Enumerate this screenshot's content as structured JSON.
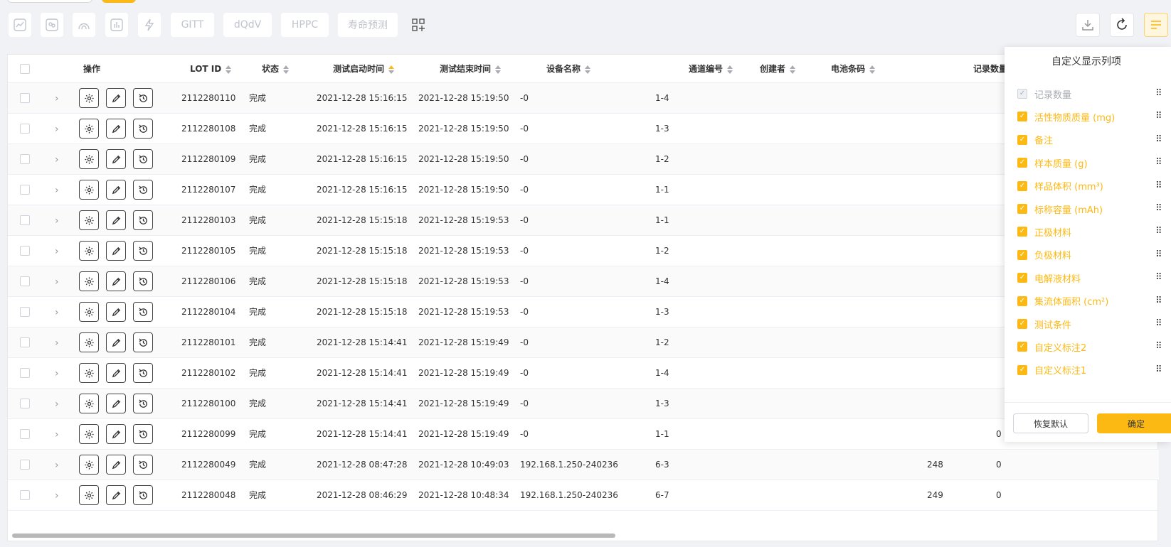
{
  "toolbar": {
    "icons": [
      "line-chart-icon",
      "cycle-icon",
      "arc-icon",
      "bar-chart-icon",
      "lightning-icon"
    ],
    "text_buttons": [
      "GITT",
      "dQdV",
      "HPPC",
      "寿命预测"
    ],
    "add_icon": "grid-add-icon",
    "right": [
      "download-icon",
      "refresh-icon",
      "columns-menu-icon"
    ]
  },
  "table": {
    "headers": {
      "ops": "操作",
      "lot": "LOT ID",
      "status": "状态",
      "start": "测试启动时间",
      "end": "测试结束时间",
      "device": "设备名称",
      "channel": "通道编号",
      "creator": "创建者",
      "barcode": "电池条码",
      "records": "记录数量"
    },
    "rows": [
      {
        "lot": "2112280110",
        "status": "完成",
        "start": "2021-12-28 15:16:15",
        "end": "2021-12-28 15:19:50",
        "device": "-0",
        "channel": "1-4",
        "records": "",
        "extra": ""
      },
      {
        "lot": "2112280108",
        "status": "完成",
        "start": "2021-12-28 15:16:15",
        "end": "2021-12-28 15:19:50",
        "device": "-0",
        "channel": "1-3",
        "records": "",
        "extra": ""
      },
      {
        "lot": "2112280109",
        "status": "完成",
        "start": "2021-12-28 15:16:15",
        "end": "2021-12-28 15:19:50",
        "device": "-0",
        "channel": "1-2",
        "records": "",
        "extra": ""
      },
      {
        "lot": "2112280107",
        "status": "完成",
        "start": "2021-12-28 15:16:15",
        "end": "2021-12-28 15:19:50",
        "device": "-0",
        "channel": "1-1",
        "records": "",
        "extra": ""
      },
      {
        "lot": "2112280103",
        "status": "完成",
        "start": "2021-12-28 15:15:18",
        "end": "2021-12-28 15:19:53",
        "device": "-0",
        "channel": "1-1",
        "records": "",
        "extra": ""
      },
      {
        "lot": "2112280105",
        "status": "完成",
        "start": "2021-12-28 15:15:18",
        "end": "2021-12-28 15:19:53",
        "device": "-0",
        "channel": "1-2",
        "records": "",
        "extra": ""
      },
      {
        "lot": "2112280106",
        "status": "完成",
        "start": "2021-12-28 15:15:18",
        "end": "2021-12-28 15:19:53",
        "device": "-0",
        "channel": "1-4",
        "records": "",
        "extra": ""
      },
      {
        "lot": "2112280104",
        "status": "完成",
        "start": "2021-12-28 15:15:18",
        "end": "2021-12-28 15:19:53",
        "device": "-0",
        "channel": "1-3",
        "records": "",
        "extra": ""
      },
      {
        "lot": "2112280101",
        "status": "完成",
        "start": "2021-12-28 15:14:41",
        "end": "2021-12-28 15:19:49",
        "device": "-0",
        "channel": "1-2",
        "records": "",
        "extra": ""
      },
      {
        "lot": "2112280102",
        "status": "完成",
        "start": "2021-12-28 15:14:41",
        "end": "2021-12-28 15:19:49",
        "device": "-0",
        "channel": "1-4",
        "records": "",
        "extra": ""
      },
      {
        "lot": "2112280100",
        "status": "完成",
        "start": "2021-12-28 15:14:41",
        "end": "2021-12-28 15:19:49",
        "device": "-0",
        "channel": "1-3",
        "records": "",
        "extra": ""
      },
      {
        "lot": "2112280099",
        "status": "完成",
        "start": "2021-12-28 15:14:41",
        "end": "2021-12-28 15:19:49",
        "device": "-0",
        "channel": "1-1",
        "records": "",
        "extra": "0"
      },
      {
        "lot": "2112280049",
        "status": "完成",
        "start": "2021-12-28 08:47:28",
        "end": "2021-12-28 10:49:03",
        "device": "192.168.1.250-240236",
        "channel": "6-3",
        "records": "248",
        "extra": "0"
      },
      {
        "lot": "2112280048",
        "status": "完成",
        "start": "2021-12-28 08:46:29",
        "end": "2021-12-28 10:48:34",
        "device": "192.168.1.250-240236",
        "channel": "6-7",
        "records": "249",
        "extra": "0"
      }
    ]
  },
  "column_panel": {
    "title": "自定义显示列项",
    "items": [
      {
        "label": "记录数量",
        "checked": true,
        "disabled": true
      },
      {
        "label": "活性物质质量 (mg)",
        "checked": true,
        "disabled": false
      },
      {
        "label": "备注",
        "checked": true,
        "disabled": false
      },
      {
        "label": "样本质量 (g)",
        "checked": true,
        "disabled": false
      },
      {
        "label": "样品体积 (mm³)",
        "checked": true,
        "disabled": false
      },
      {
        "label": "标称容量 (mAh)",
        "checked": true,
        "disabled": false
      },
      {
        "label": "正极材料",
        "checked": true,
        "disabled": false
      },
      {
        "label": "负极材料",
        "checked": true,
        "disabled": false
      },
      {
        "label": "电解液材料",
        "checked": true,
        "disabled": false
      },
      {
        "label": "集流体面积 (cm²)",
        "checked": true,
        "disabled": false
      },
      {
        "label": "测试条件",
        "checked": true,
        "disabled": false
      },
      {
        "label": "自定义标注2",
        "checked": true,
        "disabled": false
      },
      {
        "label": "自定义标注1",
        "checked": true,
        "disabled": false
      }
    ],
    "reset_label": "恢复默认",
    "ok_label": "确定"
  },
  "colors": {
    "accent": "#fdb913",
    "border": "#ebeef5",
    "bg": "#f0f2f5"
  }
}
